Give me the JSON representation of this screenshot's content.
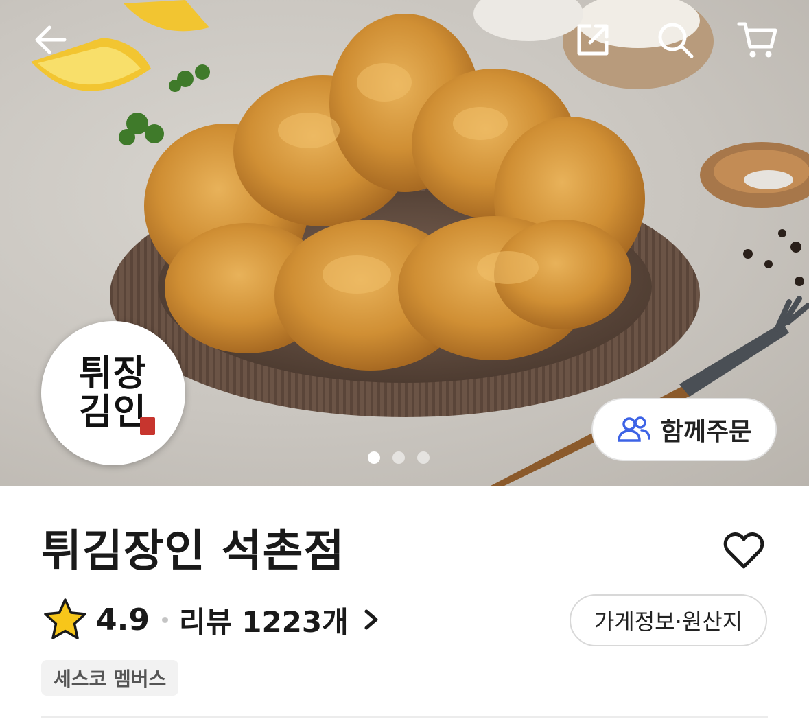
{
  "hero": {
    "group_order_label": "함께주문",
    "carousel": {
      "total": 3,
      "active_index": 1
    }
  },
  "logo": {
    "line1": "튀장",
    "line2": "김인"
  },
  "store": {
    "name": "튀김장인 석촌점",
    "rating": "4.9",
    "review_label": "리뷰",
    "review_count": "1223개",
    "info_button_label": "가게정보·원산지",
    "member_badge": "세스코 멤버스"
  },
  "colors": {
    "accent_blue": "#3d63e6",
    "star_yellow": "#f7c61a",
    "plate_brown": "#6b5446",
    "chicken_gold": "#d99a3c"
  },
  "icons": [
    "back-arrow-icon",
    "share-icon",
    "search-icon",
    "cart-icon",
    "people-icon",
    "star-icon",
    "chevron-right-icon",
    "heart-icon"
  ]
}
